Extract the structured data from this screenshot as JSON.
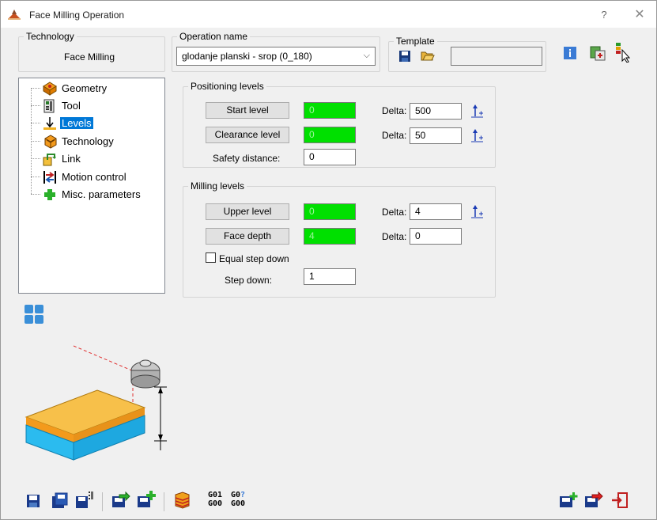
{
  "window": {
    "title": "Face Milling Operation",
    "help": "?",
    "close": "✕"
  },
  "technology": {
    "legend": "Technology",
    "value": "Face Milling"
  },
  "operation": {
    "legend": "Operation name",
    "value": "glodanje planski - srop (0_180)"
  },
  "template": {
    "legend": "Template",
    "value": ""
  },
  "tree": {
    "items": [
      {
        "label": "Geometry"
      },
      {
        "label": "Tool"
      },
      {
        "label": "Levels"
      },
      {
        "label": "Technology"
      },
      {
        "label": "Link"
      },
      {
        "label": "Motion control"
      },
      {
        "label": "Misc. parameters"
      }
    ]
  },
  "positioning": {
    "legend": "Positioning levels",
    "start_label": "Start level",
    "start_value": "0",
    "start_delta_label": "Delta:",
    "start_delta": "500",
    "clearance_label": "Clearance level",
    "clearance_value": "0",
    "clearance_delta_label": "Delta:",
    "clearance_delta": "50",
    "safety_label": "Safety distance:",
    "safety_value": "0"
  },
  "milling": {
    "legend": "Milling levels",
    "upper_label": "Upper level",
    "upper_value": "0",
    "upper_delta_label": "Delta:",
    "upper_delta": "4",
    "face_label": "Face depth",
    "face_value": "4",
    "face_delta_label": "Delta:",
    "face_delta": "0",
    "equal_step_label": "Equal step down",
    "equal_step_checked": false,
    "stepdown_label": "Step down:",
    "stepdown_value": "1"
  },
  "gcode": {
    "top1": "G01",
    "top2": "G0",
    "bottom1": "G00",
    "bottom2": "G00"
  },
  "colors": {
    "green_field": "#00e000",
    "selection": "#0078d7",
    "stock_top": "#f5b21b",
    "stock_side": "#29b6ef"
  }
}
